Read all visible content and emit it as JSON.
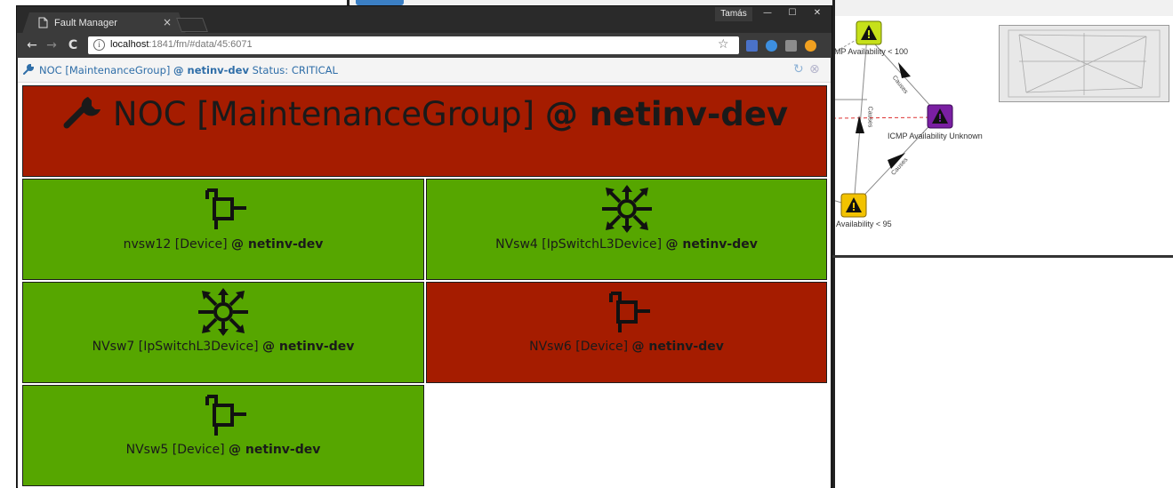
{
  "browser": {
    "tab_title": "Fault Manager",
    "tab_close": "×",
    "user": "Tamás",
    "window_controls": {
      "minimize": "—",
      "maximize": "☐",
      "close": "✕"
    },
    "nav": {
      "back": "←",
      "forward": "→",
      "reload": "C"
    },
    "url_host": "localhost",
    "url_rest": ":1841/fm/#data/45:6071",
    "bookmark_icon": "☆",
    "info_icon": "i"
  },
  "panel": {
    "title_prefix": "NOC [MaintenanceGroup]",
    "title_at": "@ netinv-dev",
    "status_label": "Status:",
    "status_value": "CRITICAL",
    "refresh_icon": "↻",
    "close_icon": "⊗"
  },
  "group": {
    "name": "NOC [MaintenanceGroup]",
    "host": "@ netinv-dev",
    "status": "critical"
  },
  "devices": [
    {
      "name": "nvsw12 [Device]",
      "host": "@ netinv-dev",
      "icon": "device-icon",
      "status": "ok"
    },
    {
      "name": "NVsw4 [IpSwitchL3Device]",
      "host": "@ netinv-dev",
      "icon": "l3-switch-icon",
      "status": "ok"
    },
    {
      "name": "NVsw7 [IpSwitchL3Device]",
      "host": "@ netinv-dev",
      "icon": "l3-switch-icon",
      "status": "ok"
    },
    {
      "name": "NVsw6 [Device]",
      "host": "@ netinv-dev",
      "icon": "device-icon",
      "status": "critical"
    },
    {
      "name": "NVsw5 [Device]",
      "host": "@ netinv-dev",
      "icon": "device-icon",
      "status": "ok"
    }
  ],
  "colors": {
    "critical": "#a51c00",
    "ok": "#56a600",
    "link": "#2f6ea8",
    "warning_yellow": "#f2c200",
    "warning_lime": "#c6e01a",
    "unknown_purple": "#7a1fa2"
  },
  "graph": {
    "nodes": [
      {
        "label": "MP Availability < 100",
        "color": "warning_lime"
      },
      {
        "label": "ICMP Availability Unknown",
        "color": "unknown_purple"
      },
      {
        "label": "Availability < 95",
        "color": "warning_yellow"
      }
    ],
    "edge_label": "Causes"
  }
}
